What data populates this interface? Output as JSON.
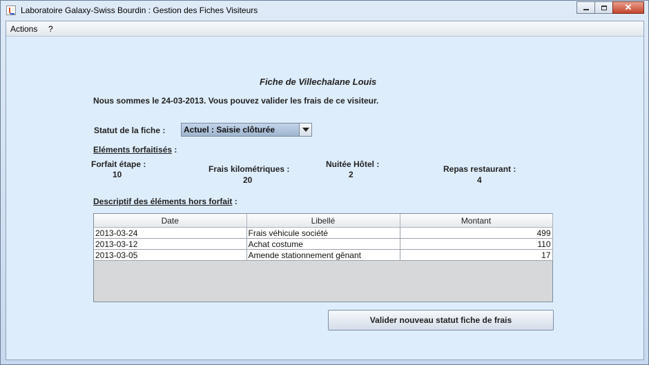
{
  "window": {
    "title": "Laboratoire Galaxy-Swiss Bourdin : Gestion des Fiches Visiteurs"
  },
  "menu": {
    "actions": "Actions",
    "help": "?"
  },
  "fiche": {
    "title": "Fiche de Villechalane Louis",
    "message": "Nous sommes le 24-03-2013. Vous pouvez valider les frais de ce visiteur.",
    "statut_label": "Statut de la fiche :",
    "statut_value": "Actuel : Saisie clôturée"
  },
  "forfait": {
    "heading": "Eléments forfaitisés",
    "heading_suffix": " :",
    "items": [
      {
        "label": "Forfait étape :",
        "value": "10"
      },
      {
        "label": "Frais kilométriques :",
        "value": "20"
      },
      {
        "label": "Nuitée Hôtel :",
        "value": "2"
      },
      {
        "label": "Repas restaurant :",
        "value": "4"
      }
    ]
  },
  "horsforfait": {
    "heading": "Descriptif des éléments hors forfait",
    "heading_suffix": " :",
    "columns": [
      "Date",
      "Libellé",
      "Montant"
    ],
    "rows": [
      {
        "date": "2013-03-24",
        "libelle": "Frais véhicule société",
        "montant": "499"
      },
      {
        "date": "2013-03-12",
        "libelle": "Achat costume",
        "montant": "110"
      },
      {
        "date": "2013-03-05",
        "libelle": "Amende stationnement gênant",
        "montant": "17"
      }
    ]
  },
  "button": {
    "valider": "Valider nouveau statut fiche de frais"
  }
}
